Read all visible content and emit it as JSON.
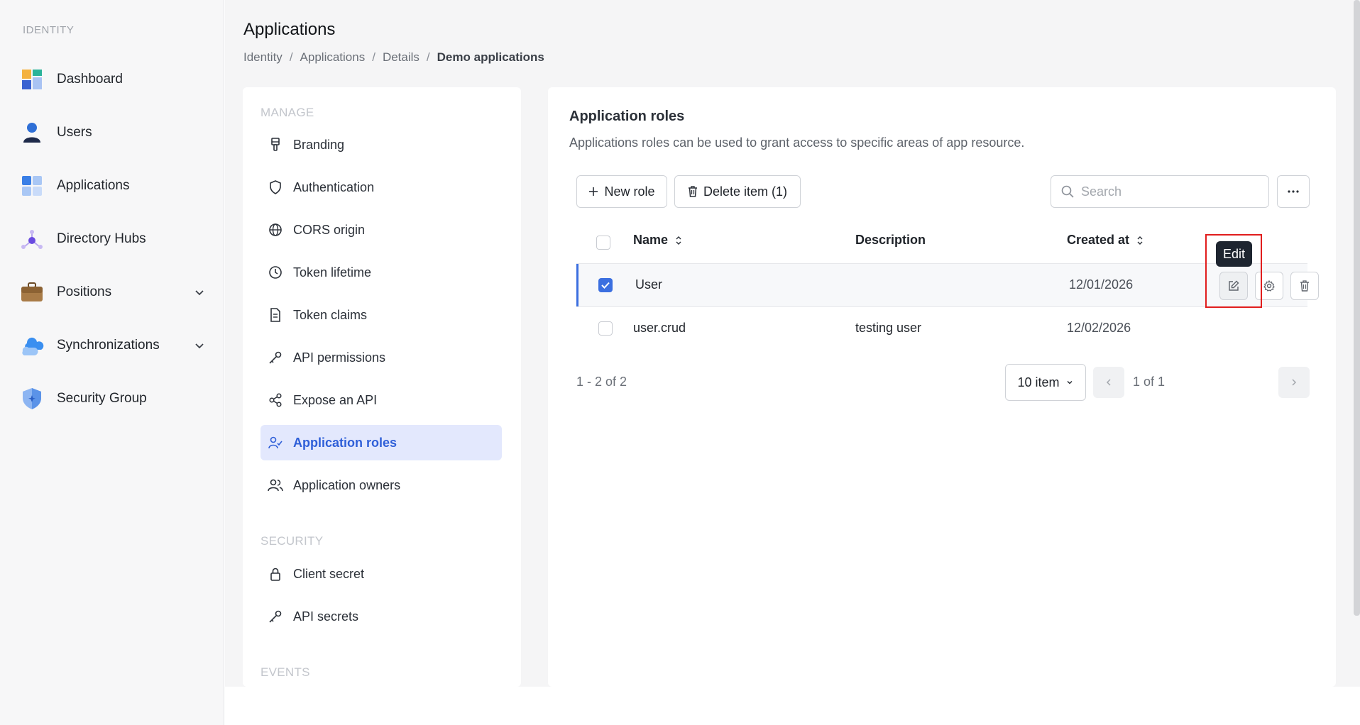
{
  "sidebar": {
    "section_label": "IDENTITY",
    "items": [
      {
        "label": "Dashboard",
        "icon": "dashboard-icon"
      },
      {
        "label": "Users",
        "icon": "user-icon"
      },
      {
        "label": "Applications",
        "icon": "applications-icon"
      },
      {
        "label": "Directory Hubs",
        "icon": "hub-icon"
      },
      {
        "label": "Positions",
        "icon": "briefcase-icon",
        "expandable": true
      },
      {
        "label": "Synchronizations",
        "icon": "cloud-sync-icon",
        "expandable": true
      },
      {
        "label": "Security Group",
        "icon": "shield-icon"
      }
    ]
  },
  "header": {
    "title": "Applications",
    "breadcrumb": [
      "Identity",
      "Applications",
      "Details",
      "Demo applications"
    ]
  },
  "submenu": {
    "manage_label": "MANAGE",
    "manage_items": [
      {
        "label": "Branding",
        "icon": "brush-icon"
      },
      {
        "label": "Authentication",
        "icon": "shield-outline-icon"
      },
      {
        "label": "CORS origin",
        "icon": "globe-icon"
      },
      {
        "label": "Token lifetime",
        "icon": "clock-icon"
      },
      {
        "label": "Token claims",
        "icon": "document-icon"
      },
      {
        "label": "API permissions",
        "icon": "key-icon"
      },
      {
        "label": "Expose an API",
        "icon": "share-icon"
      },
      {
        "label": "Application roles",
        "icon": "user-check-icon",
        "active": true
      },
      {
        "label": "Application owners",
        "icon": "users-icon"
      }
    ],
    "security_label": "SECURITY",
    "security_items": [
      {
        "label": "Client secret",
        "icon": "lock-icon"
      },
      {
        "label": "API secrets",
        "icon": "key-icon"
      }
    ],
    "events_label": "EVENTS"
  },
  "roles": {
    "title": "Application roles",
    "description": "Applications roles can be used to grant access to specific areas of app resource.",
    "new_role_label": "New role",
    "delete_label": "Delete item (1)",
    "search_placeholder": "Search",
    "columns": {
      "name": "Name",
      "description": "Description",
      "created_at": "Created at"
    },
    "rows": [
      {
        "name": "User",
        "description": "",
        "created_at": "12/01/2026",
        "selected": true
      },
      {
        "name": "user.crud",
        "description": "testing user",
        "created_at": "12/02/2026",
        "selected": false
      }
    ],
    "tooltip": "Edit",
    "pagination": {
      "range": "1 - 2 of 2",
      "page_size": "10 item",
      "page_of": "1 of 1"
    }
  },
  "colors": {
    "accent": "#3b6fe0",
    "active_bg": "#e3e8fd",
    "highlight": "#e11d1d"
  }
}
